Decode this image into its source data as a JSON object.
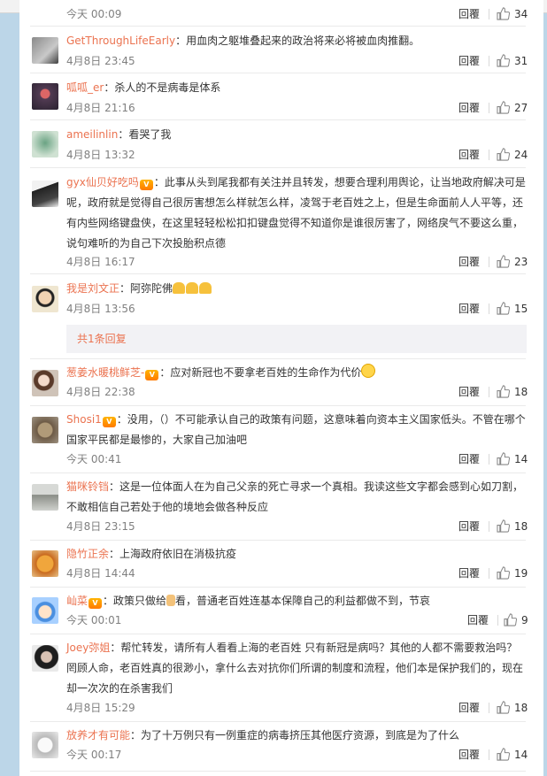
{
  "colors": {
    "username": "#eb7350",
    "text": "#333333",
    "time": "#808080"
  },
  "reply_label": "回覆",
  "top_partial": {
    "time": "今天 00:09",
    "likes": "34"
  },
  "comments": [
    {
      "username": "GetThroughLifeEarly",
      "text": "：用血肉之躯堆叠起来的政治将来必将被血肉推翻。",
      "time": "4月8日 23:45",
      "likes": "31",
      "avatar": "gray-portrait"
    },
    {
      "username": "呱呱_er",
      "text": "：杀人的不是病毒是体系",
      "time": "4月8日 21:16",
      "likes": "27",
      "avatar": "dark-portrait"
    },
    {
      "username": "ameilinlin",
      "text": "：看哭了我",
      "time": "4月8日 13:32",
      "likes": "24",
      "avatar": "green-portrait"
    },
    {
      "username": "gyx仙贝好吃吗",
      "badge": true,
      "text": "：此事从头到尾我都有关注并且转发，想要合理利用舆论，让当地政府解决可是呢，政府就是觉得自己很厉害想怎么样就怎么样，凌驾于老百姓之上，但是生命面前人人平等，还有内些网络键盘侠，在这里轻轻松松扣扣键盘觉得不知道你是谁很厉害了，网络戾气不要这么重，说句难听的为自己下次投胎积点德",
      "time": "4月8日 16:17",
      "likes": "23",
      "avatar": "bw-portrait"
    },
    {
      "username": "我是刘文正",
      "text": "：阿弥陀佛",
      "pray": true,
      "time": "4月8日 13:56",
      "likes": "15",
      "avatar": "man-portrait"
    },
    {
      "username": "葱姜水暖桃鲜芝-",
      "badge": true,
      "text": "：应对新冠也不要拿老百姓的生命作为代价",
      "emoji": true,
      "time": "4月8日 22:38",
      "likes": "18",
      "avatar": "girl-portrait"
    },
    {
      "username": "Shosi1",
      "badge": true,
      "text": "：没用，（）不可能承认自己的政策有问题，这意味着向资本主义国家低头。不管在哪个国家平民都是最惨的，大家自己加油吧",
      "time": "今天 00:41",
      "likes": "14",
      "avatar": "cat-portrait"
    },
    {
      "username": "猫咪铃铛",
      "text": "：这是一位体面人在为自己父亲的死亡寻求一个真相。我读这些文字都会感到心如刀割，不敢相信自己若处于他的境地会做各种反应",
      "time": "4月8日 23:15",
      "likes": "18",
      "avatar": "scene-portrait"
    },
    {
      "username": "隐竹正余",
      "text": "：上海政府依旧在消极抗疫",
      "time": "4月8日 14:44",
      "likes": "19",
      "avatar": "dog-portrait"
    },
    {
      "username": "屾菜",
      "badge": true,
      "text": "：政策只做给",
      "text2": "看，普通老百姓连基本保障自己的利益都做不到，节哀",
      "hand": true,
      "time": "今天 00:01",
      "likes": "9",
      "avatar": "cartoon-portrait"
    },
    {
      "username": "Joey弥姐",
      "text": "：帮忙转发，请所有人看看上海的老百姓 只有新冠是病吗？其他的人都不需要救治吗？罔顾人命，老百姓真的很渺小，拿什么去对抗你们所谓的制度和流程，他们本是保护我们的，现在却一次次的在杀害我们",
      "time": "4月8日 15:29",
      "likes": "18",
      "avatar": "woman-portrait"
    },
    {
      "username": "放养才有可能",
      "text": "：为了十万例只有一例重症的病毒挤压其他医疗资源，到底是为了什么",
      "time": "今天 00:17",
      "likes": "14",
      "avatar": "white-portrait"
    }
  ],
  "more_replies": "共1条回复"
}
